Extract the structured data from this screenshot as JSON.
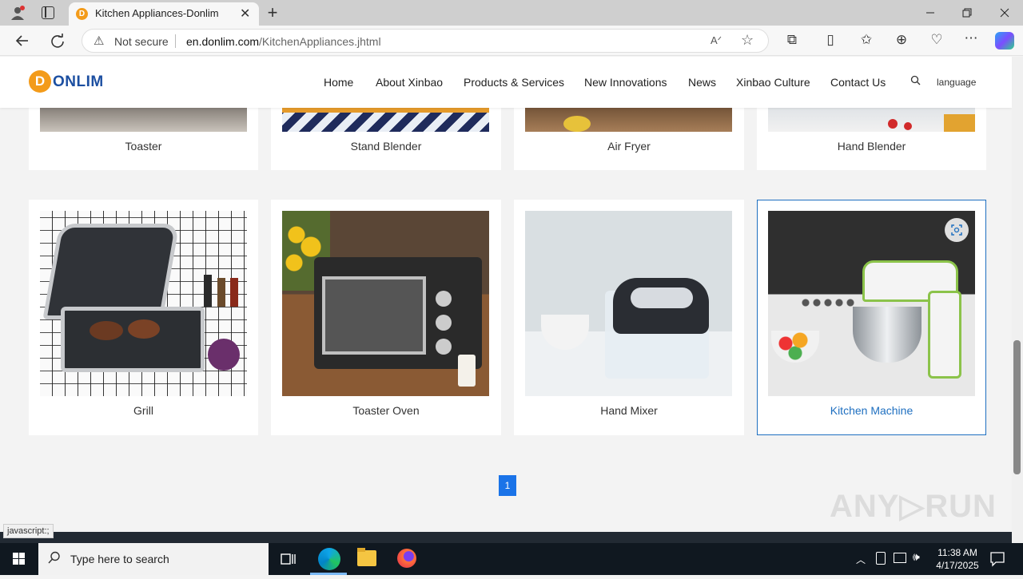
{
  "browser": {
    "tab_title": "Kitchen Appliances-Donlim",
    "tab_favicon": "D",
    "new_tab": "+",
    "close_tab": "✕",
    "security_label": "Not secure",
    "url_domain": "en.donlim.com",
    "url_path": "/KitchenAppliances.jhtml"
  },
  "site": {
    "logo_letter": "D",
    "logo_text": "ONLIM",
    "nav": [
      "Home",
      "About Xinbao",
      "Products & Services",
      "New Innovations",
      "News",
      "Xinbao Culture",
      "Contact Us"
    ],
    "language": "language",
    "top_row": [
      "Toaster",
      "Stand Blender",
      "Air Fryer",
      "Hand Blender"
    ],
    "products": [
      {
        "label": "Grill"
      },
      {
        "label": "Toaster Oven"
      },
      {
        "label": "Hand Mixer"
      },
      {
        "label": "Kitchen Machine"
      }
    ],
    "page_number": "1",
    "status_text": "javascript:;",
    "watermark": "ANY▷RUN"
  },
  "taskbar": {
    "search_placeholder": "Type here to search",
    "time": "11:38 AM",
    "date": "4/17/2025"
  },
  "colors": {
    "accent": "#1e6fc0",
    "pager": "#1a73e8",
    "logo_orange": "#f39b1a"
  }
}
